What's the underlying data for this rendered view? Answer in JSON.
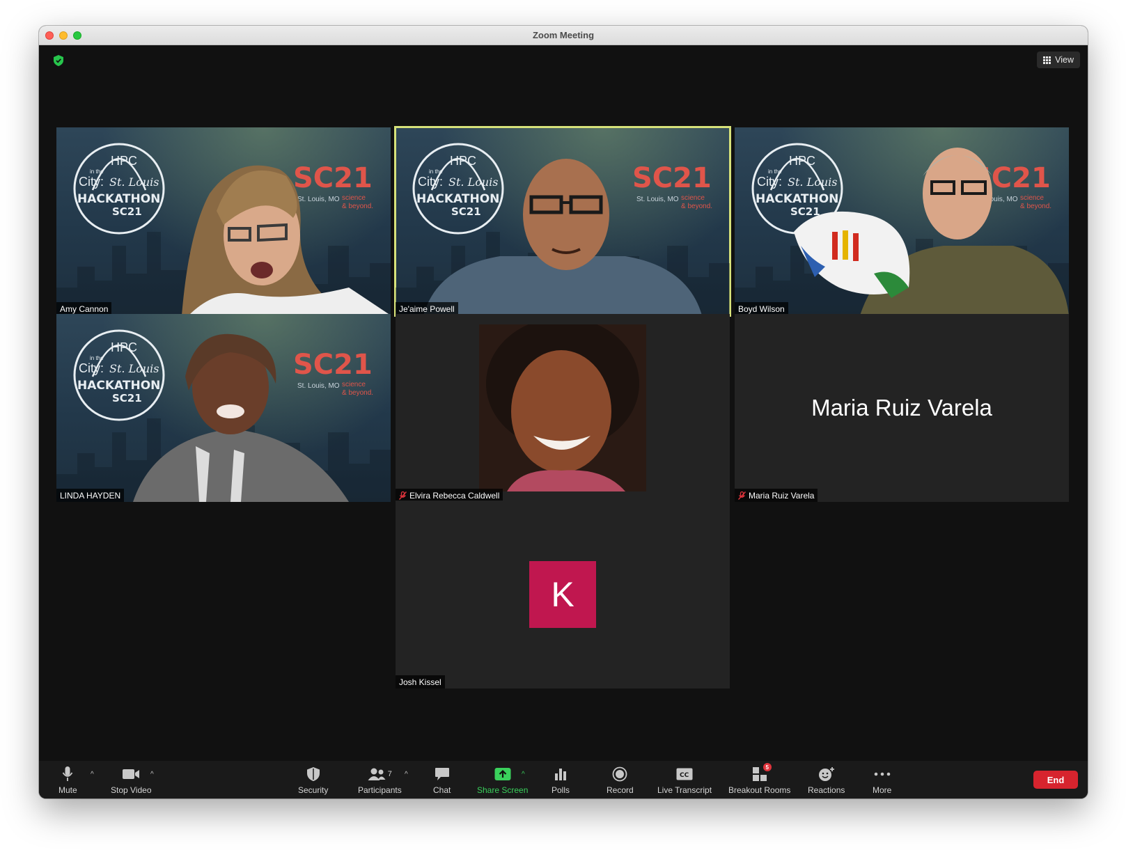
{
  "window": {
    "title": "Zoom Meeting"
  },
  "top_bar": {
    "view_label": "View"
  },
  "participants": [
    {
      "name": "Amy Cannon",
      "muted": false,
      "video": "virtual-background"
    },
    {
      "name": "Je'aime Powell",
      "muted": false,
      "video": "virtual-background",
      "active_speaker": true
    },
    {
      "name": "Boyd Wilson",
      "muted": false,
      "video": "virtual-background"
    },
    {
      "name": "LINDA HAYDEN",
      "muted": false,
      "video": "virtual-background"
    },
    {
      "name": "Elvira Rebecca Caldwell",
      "muted": true,
      "video": "photo"
    },
    {
      "name": "Maria Ruiz Varela",
      "muted": true,
      "video": "off",
      "display_name": "Maria Ruiz Varela"
    },
    {
      "name": "Josh Kissel",
      "muted": false,
      "video": "avatar",
      "avatar_letter": "K"
    }
  ],
  "background_branding": {
    "badge_top": "HPC",
    "badge_in_the": "in the",
    "badge_city": "City:",
    "badge_script": "St. Louis",
    "badge_main": "HACKATHON",
    "badge_sc": "SC21",
    "sc_logo": "SC21",
    "sc_location": "St. Louis, MO",
    "sc_tagline_1": "science",
    "sc_tagline_2": "& beyond."
  },
  "toolbar": {
    "mute": "Mute",
    "stop_video": "Stop Video",
    "security": "Security",
    "participants": "Participants",
    "participants_count": "7",
    "chat": "Chat",
    "share_screen": "Share Screen",
    "polls": "Polls",
    "record": "Record",
    "live_transcript": "Live Transcript",
    "breakout_rooms": "Breakout Rooms",
    "breakout_badge": "5",
    "reactions": "Reactions",
    "more": "More",
    "end": "End"
  },
  "colors": {
    "active_speaker_border": "#d7e27a",
    "end_button": "#d7242e",
    "share_screen": "#3ad15c",
    "avatar_k": "#c0174f",
    "security_shield": "#27c54c"
  }
}
